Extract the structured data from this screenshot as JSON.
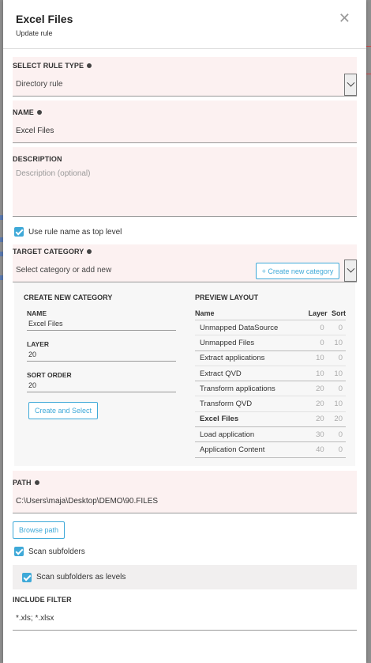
{
  "modal": {
    "title": "Excel Files",
    "subtitle": "Update rule"
  },
  "rule_type": {
    "label": "SELECT RULE TYPE",
    "value": "Directory rule"
  },
  "name": {
    "label": "NAME",
    "value": "Excel Files"
  },
  "description": {
    "label": "DESCRIPTION",
    "placeholder": "Description (optional)"
  },
  "top_level": {
    "label": "Use rule name as top level",
    "checked": true
  },
  "target_category": {
    "label": "TARGET CATEGORY",
    "placeholder": "Select category or add new",
    "create_button": "+ Create new category"
  },
  "new_category": {
    "heading": "CREATE NEW CATEGORY",
    "name_label": "NAME",
    "name_value": "Excel Files",
    "layer_label": "LAYER",
    "layer_value": "20",
    "sort_label": "SORT ORDER",
    "sort_value": "20",
    "submit": "Create and Select"
  },
  "preview": {
    "heading": "PREVIEW LAYOUT",
    "columns": [
      "Name",
      "Layer",
      "Sort"
    ],
    "rows": [
      {
        "name": "Unmapped DataSource",
        "layer": "0",
        "sort": "0"
      },
      {
        "name": "Unmapped Files",
        "layer": "0",
        "sort": "10"
      },
      {
        "name": "Extract applications",
        "layer": "10",
        "sort": "0"
      },
      {
        "name": "Extract QVD",
        "layer": "10",
        "sort": "10"
      },
      {
        "name": "Transform applications",
        "layer": "20",
        "sort": "0"
      },
      {
        "name": "Transform QVD",
        "layer": "20",
        "sort": "10"
      },
      {
        "name": "Excel Files",
        "layer": "20",
        "sort": "20"
      },
      {
        "name": "Load application",
        "layer": "30",
        "sort": "0"
      },
      {
        "name": "Application Content",
        "layer": "40",
        "sort": "0"
      }
    ]
  },
  "path": {
    "label": "PATH",
    "value": "C:\\Users\\maja\\Desktop\\DEMO\\90.FILES",
    "browse": "Browse path"
  },
  "scan_subfolders": {
    "label": "Scan subfolders",
    "checked": true
  },
  "scan_as_levels": {
    "label": "Scan subfolders as levels",
    "checked": true
  },
  "include_filter": {
    "label": "INCLUDE FILTER",
    "value": "*.xls; *.xlsx"
  },
  "colors": {
    "accent": "#3fa9d8",
    "required_bg": "#fcf1f1"
  }
}
